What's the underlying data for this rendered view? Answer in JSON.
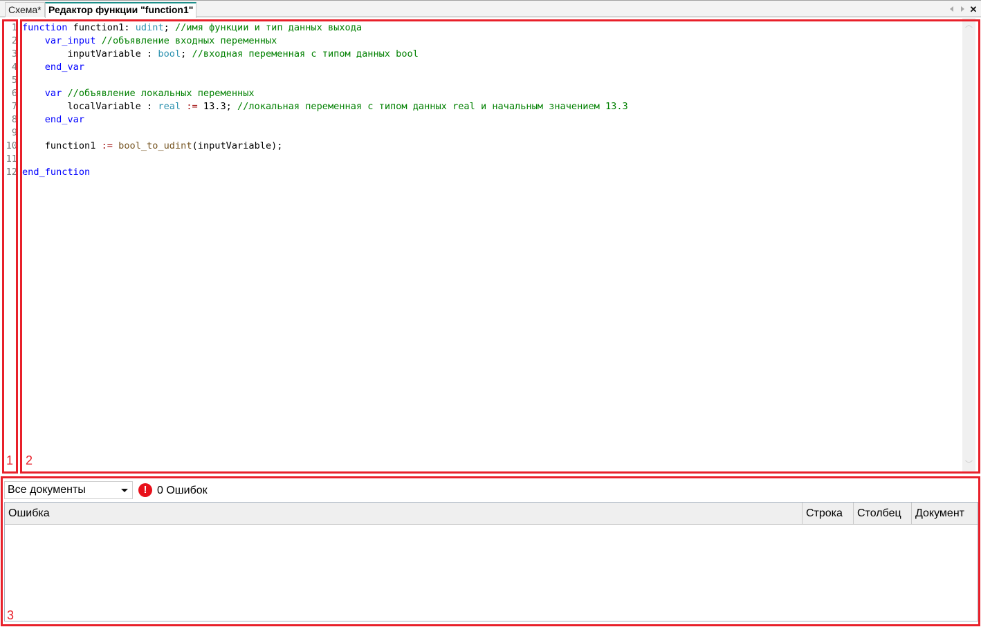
{
  "tabs": [
    {
      "label": "Схема*",
      "active": false
    },
    {
      "label": "Редактор функции \"function1\"",
      "active": true
    }
  ],
  "tab_controls": {
    "prev_icon": "chevron-left-icon",
    "next_icon": "chevron-right-icon",
    "close_icon": "close-icon"
  },
  "editor": {
    "line_numbers": [
      "1",
      "2",
      "3",
      "4",
      "5",
      "6",
      "7",
      "8",
      "9",
      "10",
      "11",
      "12"
    ],
    "lines": [
      [
        {
          "t": "kw",
          "v": "function"
        },
        {
          "t": "id",
          "v": " function1: "
        },
        {
          "t": "ty",
          "v": "udint"
        },
        {
          "t": "id",
          "v": "; "
        },
        {
          "t": "cm",
          "v": "//имя функции и тип данных выхода"
        }
      ],
      [
        {
          "t": "id",
          "v": "    "
        },
        {
          "t": "kw",
          "v": "var_input"
        },
        {
          "t": "id",
          "v": " "
        },
        {
          "t": "cm",
          "v": "//объявление входных переменных"
        }
      ],
      [
        {
          "t": "id",
          "v": "        inputVariable : "
        },
        {
          "t": "ty",
          "v": "bool"
        },
        {
          "t": "id",
          "v": "; "
        },
        {
          "t": "cm",
          "v": "//входная переменная с типом данных bool"
        }
      ],
      [
        {
          "t": "id",
          "v": "    "
        },
        {
          "t": "kw",
          "v": "end_var"
        }
      ],
      [],
      [
        {
          "t": "id",
          "v": "    "
        },
        {
          "t": "kw",
          "v": "var"
        },
        {
          "t": "id",
          "v": " "
        },
        {
          "t": "cm",
          "v": "//объявление локальных переменных"
        }
      ],
      [
        {
          "t": "id",
          "v": "        localVariable : "
        },
        {
          "t": "ty",
          "v": "real"
        },
        {
          "t": "id",
          "v": " "
        },
        {
          "t": "op",
          "v": ":="
        },
        {
          "t": "num",
          "v": " 13.3"
        },
        {
          "t": "id",
          "v": "; "
        },
        {
          "t": "cm",
          "v": "//локальная переменная с типом данных real и начальным значением 13.3"
        }
      ],
      [
        {
          "t": "id",
          "v": "    "
        },
        {
          "t": "kw",
          "v": "end_var"
        }
      ],
      [],
      [
        {
          "t": "id",
          "v": "    function1 "
        },
        {
          "t": "op",
          "v": ":="
        },
        {
          "t": "id",
          "v": " "
        },
        {
          "t": "fn",
          "v": "bool_to_udint"
        },
        {
          "t": "id",
          "v": "(inputVariable);"
        }
      ],
      [],
      [
        {
          "t": "kw",
          "v": "end_function"
        }
      ]
    ]
  },
  "annotations": {
    "box1": "1",
    "box2": "2",
    "box3": "3"
  },
  "error_panel": {
    "scope_select": "Все документы",
    "error_icon": "error-exclamation-icon",
    "error_count": "0 Ошибок",
    "columns": [
      "Ошибка",
      "Строка",
      "Столбец",
      "Документ"
    ],
    "rows": []
  },
  "colors": {
    "keyword": "#0000ff",
    "type": "#2b91af",
    "comment": "#008000",
    "operator": "#a31515",
    "annotation": "#e8202a",
    "error_badge": "#e8101a",
    "active_tab_accent": "#1e8f8a"
  }
}
